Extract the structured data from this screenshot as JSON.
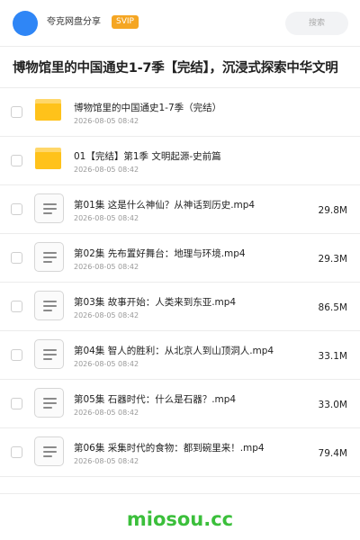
{
  "header": {
    "site_name": "夸克网盘分享",
    "badge": "SVIP",
    "search_placeholder": "搜索"
  },
  "page_title": "博物馆里的中国通史1-7季【完结】，沉浸式探索中华文明",
  "items": [
    {
      "type": "folder",
      "name": "博物馆里的中国通史1-7季（完结）",
      "date": "2026-08-05 08:42",
      "size": ""
    },
    {
      "type": "folder",
      "name": "01【完结】第1季 文明起源-史前篇",
      "date": "2026-08-05 08:42",
      "size": ""
    },
    {
      "type": "file",
      "name": "第01集 这是什么神仙？从神话到历史.mp4",
      "date": "2026-08-05 08:42",
      "size": "29.8M"
    },
    {
      "type": "file",
      "name": "第02集 先布置好舞台：地理与环境.mp4",
      "date": "2026-08-05 08:42",
      "size": "29.3M"
    },
    {
      "type": "file",
      "name": "第03集 故事开始：人类来到东亚.mp4",
      "date": "2026-08-05 08:42",
      "size": "86.5M"
    },
    {
      "type": "file",
      "name": "第04集 智人的胜利：从北京人到山顶洞人.mp4",
      "date": "2026-08-05 08:42",
      "size": "33.1M"
    },
    {
      "type": "file",
      "name": "第05集 石器时代：什么是石器？.mp4",
      "date": "2026-08-05 08:42",
      "size": "33.0M"
    },
    {
      "type": "file",
      "name": "第06集 采集时代的食物：都到碗里来！.mp4",
      "date": "2026-08-05 08:42",
      "size": "79.4M"
    }
  ],
  "footer": {
    "brand": "miosou.cc"
  }
}
